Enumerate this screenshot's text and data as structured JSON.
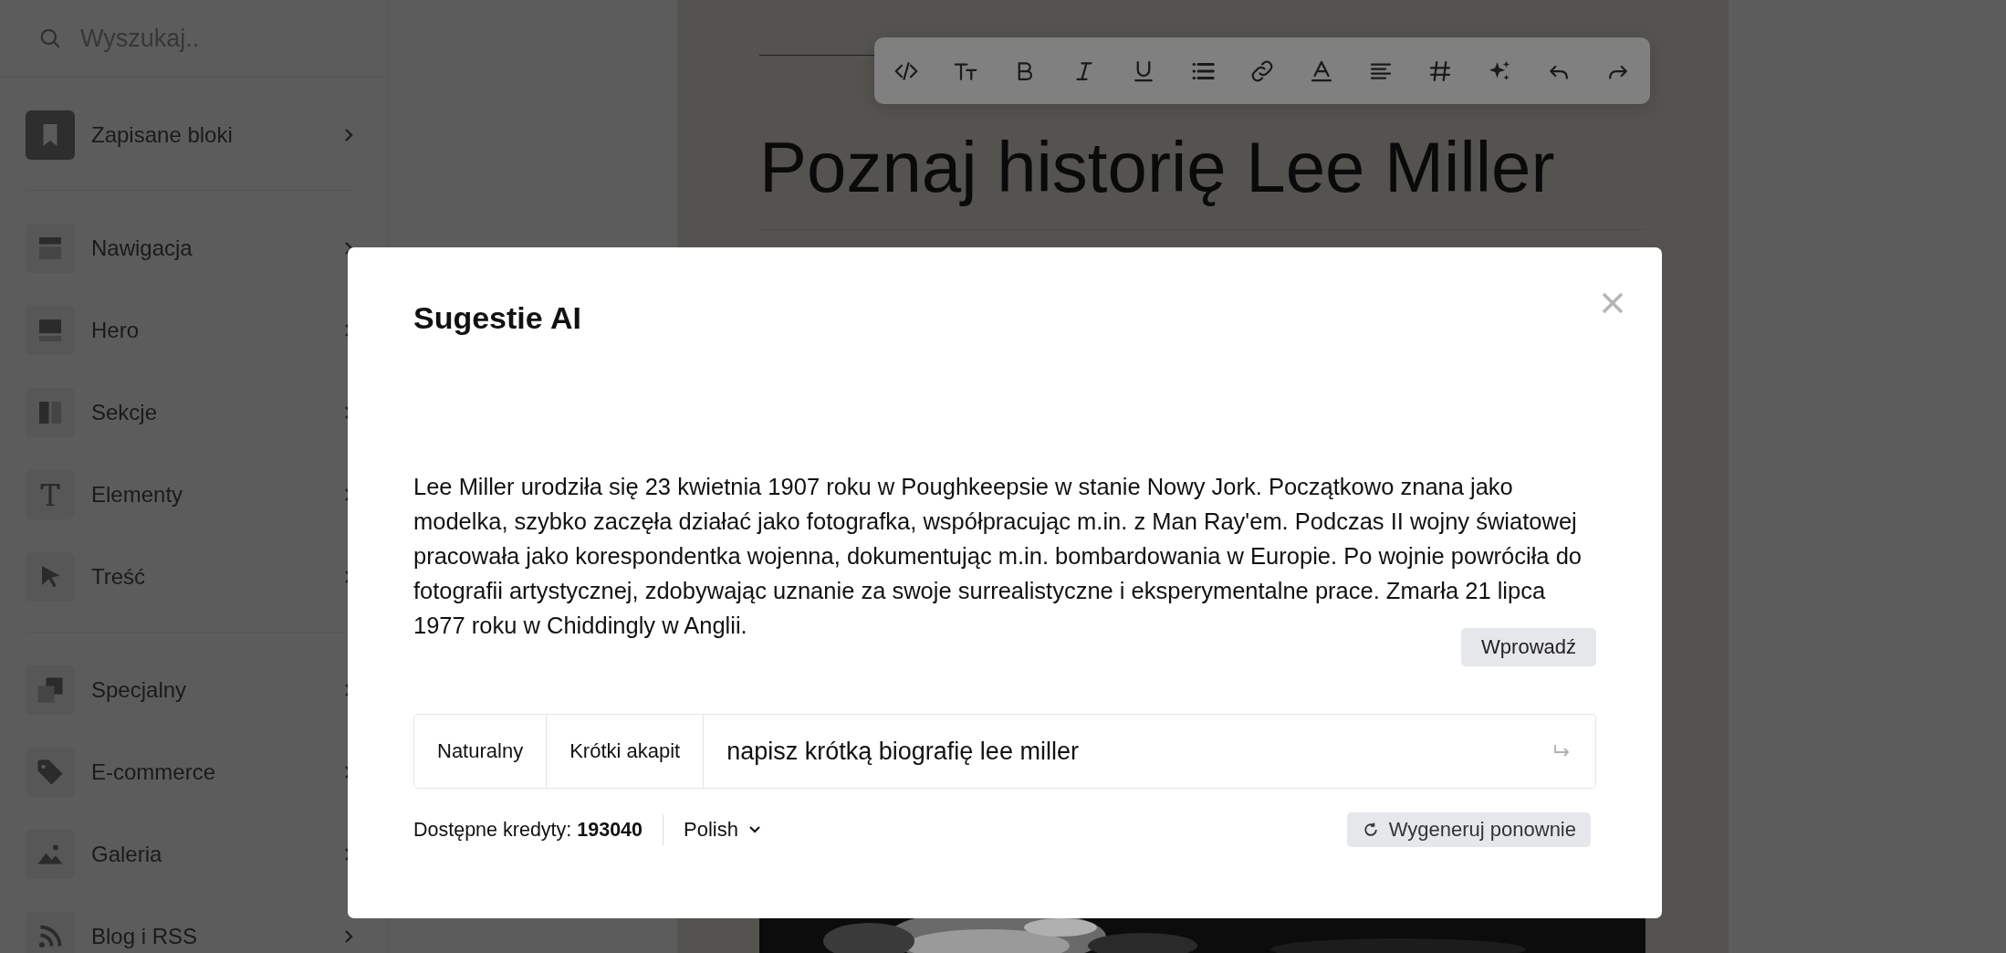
{
  "sidebar": {
    "search": {
      "placeholder": "Wyszukaj.."
    },
    "groups": [
      {
        "items": [
          {
            "label": "Zapisane bloki"
          }
        ]
      },
      {
        "items": [
          {
            "label": "Nawigacja"
          },
          {
            "label": "Hero"
          },
          {
            "label": "Sekcje"
          },
          {
            "label": "Elementy"
          },
          {
            "label": "Treść"
          }
        ]
      },
      {
        "items": [
          {
            "label": "Specjalny"
          },
          {
            "label": "E-commerce"
          },
          {
            "label": "Galeria"
          },
          {
            "label": "Blog i RSS"
          }
        ]
      }
    ]
  },
  "editor": {
    "title": "Poznaj historię Lee Miller"
  },
  "modal": {
    "title": "Sugestie AI",
    "suggestion": "Lee Miller urodziła się 23 kwietnia 1907 roku w Poughkeepsie w stanie Nowy Jork. Początkowo znana jako modelka, szybko zaczęła działać jako fotografka, współpracując m.in. z Man Ray'em. Podczas II wojny światowej pracowała jako korespondentka wojenna, dokumentując m.in. bombardowania w Europie. Po wojnie powróciła do fotografii artystycznej, zdobywając uznanie za swoje surrealistyczne i eksperymentalne prace. Zmarła 21 lipca 1977 roku w Chiddingly w Anglii.",
    "insert_button": "Wprowadź",
    "styles": [
      "Naturalny",
      "Krótki akapit"
    ],
    "prompt": {
      "value": "napisz krótką biografię lee miller"
    },
    "credits": {
      "label": "Dostępne kredyty:",
      "value": "193040"
    },
    "language": "Polish",
    "regenerate_button": "Wygeneruj ponownie"
  }
}
